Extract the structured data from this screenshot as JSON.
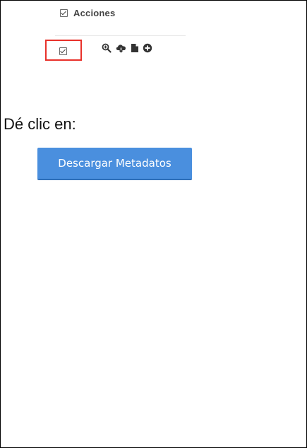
{
  "table": {
    "header_label": "Acciones"
  },
  "icons": [
    "magnifier-zoom-icon",
    "cloud-download-icon",
    "document-icon",
    "plus-circle-icon"
  ],
  "colors": {
    "highlight": "#e8312a",
    "button_bg": "#4a8fde",
    "button_text": "#ffffff"
  },
  "instruction": {
    "text": "Dé clic en:"
  },
  "button": {
    "label": "Descargar Metadatos"
  }
}
